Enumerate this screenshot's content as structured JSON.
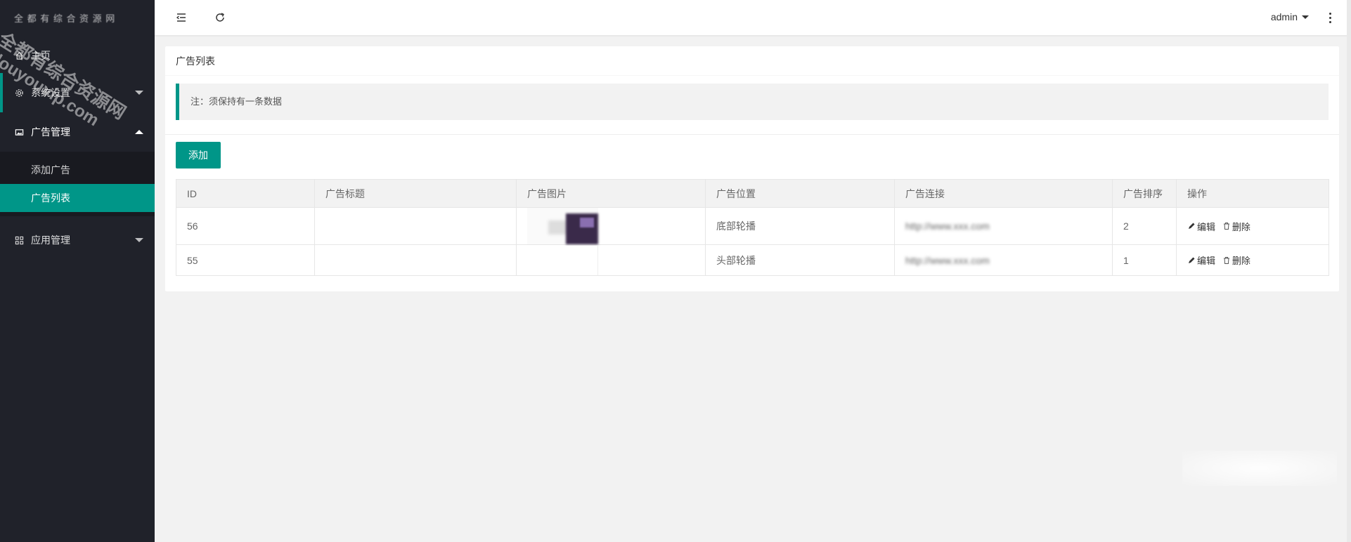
{
  "logo": {
    "text": "全 都 有 综 合 资 源 网"
  },
  "watermark": {
    "line1": "全都有综合资源网",
    "line2": "douyouvip.com"
  },
  "sidebar": {
    "items": [
      {
        "label": "主页",
        "icon": "home-icon"
      },
      {
        "label": "系统设置",
        "icon": "gear-icon"
      },
      {
        "label": "广告管理",
        "icon": "image-icon"
      },
      {
        "label": "应用管理",
        "icon": "apps-icon"
      }
    ],
    "sub_items": [
      {
        "label": "添加广告"
      },
      {
        "label": "广告列表"
      }
    ]
  },
  "header": {
    "user": "admin"
  },
  "card": {
    "title": "广告列表",
    "note": "注：须保持有一条数据",
    "add_button": "添加"
  },
  "table": {
    "headers": [
      "ID",
      "广告标题",
      "广告图片",
      "广告位置",
      "广告连接",
      "广告排序",
      "操作"
    ],
    "rows": [
      {
        "id": "56",
        "title": "",
        "position": "底部轮播",
        "link": "http://www.xxx.com",
        "sort": "2"
      },
      {
        "id": "55",
        "title": "",
        "position": "头部轮播",
        "link": "http://www.xxx.com",
        "sort": "1"
      }
    ],
    "edit_label": "编辑",
    "delete_label": "删除"
  },
  "colors": {
    "accent": "#009688",
    "sidebar": "#20222a",
    "sidebar_sub": "#191a20"
  }
}
